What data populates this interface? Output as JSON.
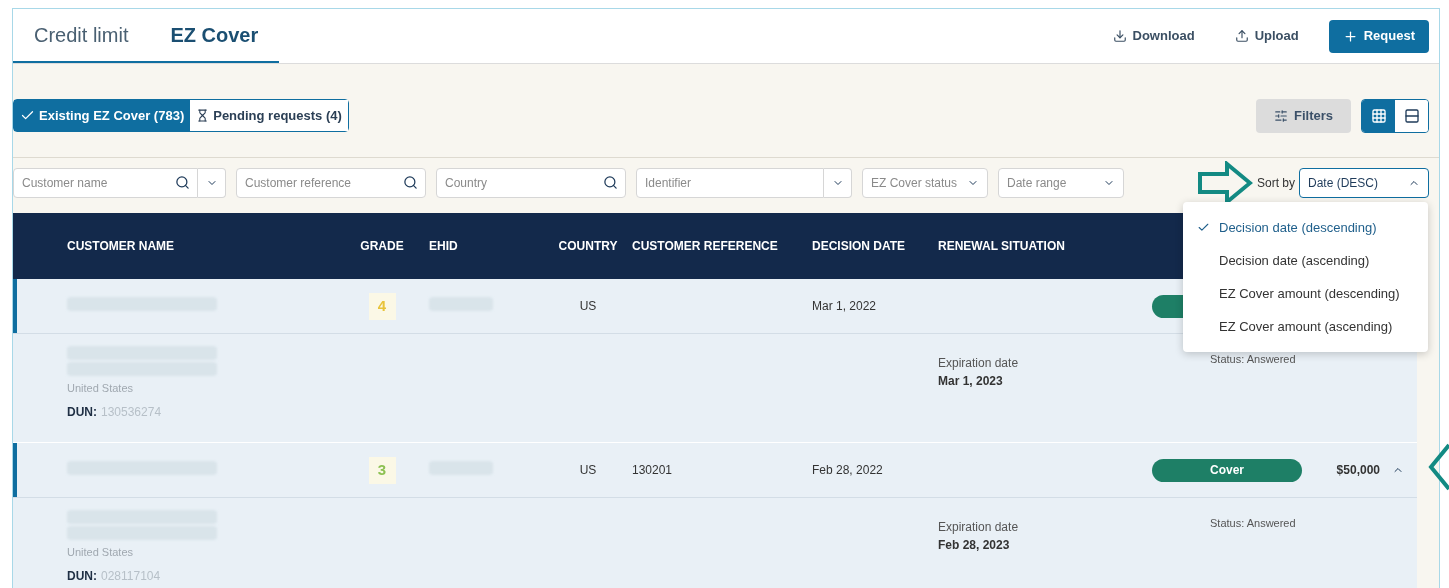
{
  "tabs": [
    {
      "label": "Credit limit",
      "selected": false
    },
    {
      "label": "EZ Cover",
      "selected": true
    }
  ],
  "header_buttons": {
    "download": "Download",
    "upload": "Upload",
    "request": "Request"
  },
  "segments": [
    {
      "label": "Existing EZ Cover (783)",
      "selected": true
    },
    {
      "label": "Pending requests (4)",
      "selected": false
    }
  ],
  "filters_button": "Filters",
  "view_toggle": [
    {
      "selected": true
    },
    {
      "selected": false
    }
  ],
  "filters": [
    {
      "kind": "search_menu",
      "placeholder": "Customer name"
    },
    {
      "kind": "search",
      "placeholder": "Customer reference"
    },
    {
      "kind": "search",
      "placeholder": "Country"
    },
    {
      "kind": "menu",
      "placeholder": "Identifier"
    },
    {
      "kind": "select",
      "placeholder": "EZ Cover status"
    },
    {
      "kind": "select",
      "placeholder": "Date range"
    }
  ],
  "sort": {
    "label": "Sort by",
    "value": "Date (DESC)",
    "expanded": true,
    "options": [
      {
        "label": "Decision date (descending)",
        "selected": true
      },
      {
        "label": "Decision date (ascending)",
        "selected": false
      },
      {
        "label": "EZ Cover amount (descending)",
        "selected": false
      },
      {
        "label": "EZ Cover amount (ascending)",
        "selected": false
      }
    ]
  },
  "table": {
    "columns": [
      "CUSTOMER NAME",
      "GRADE",
      "EHID",
      "COUNTRY",
      "CUSTOMER REFERENCE",
      "DECISION DATE",
      "RENEWAL SITUATION"
    ],
    "rows": [
      {
        "grade": "4",
        "color": "#e8c33a",
        "country": "US",
        "decision_date": "Mar 1, 2022",
        "status": {},
        "detail": {
          "country_line": "United States",
          "dun_label": "DUN:",
          "dun": "130536274",
          "expiration_label": "Expiration date",
          "expiration": "Mar 1, 2023",
          "status_text": "Status: Answered"
        }
      },
      {
        "grade": "3",
        "color": "#8cc152",
        "country": "US",
        "customer_reference": "130201",
        "decision_date": "Feb 28, 2022",
        "status": {
          "label": "Cover"
        },
        "amount": "$50,000",
        "expanded": true,
        "detail": {
          "country_line": "United States",
          "dun_label": "DUN:",
          "dun": "028117104",
          "expiration_label": "Expiration date",
          "expiration": "Feb 28, 2023",
          "status_text": "Status: Answered"
        }
      }
    ]
  }
}
